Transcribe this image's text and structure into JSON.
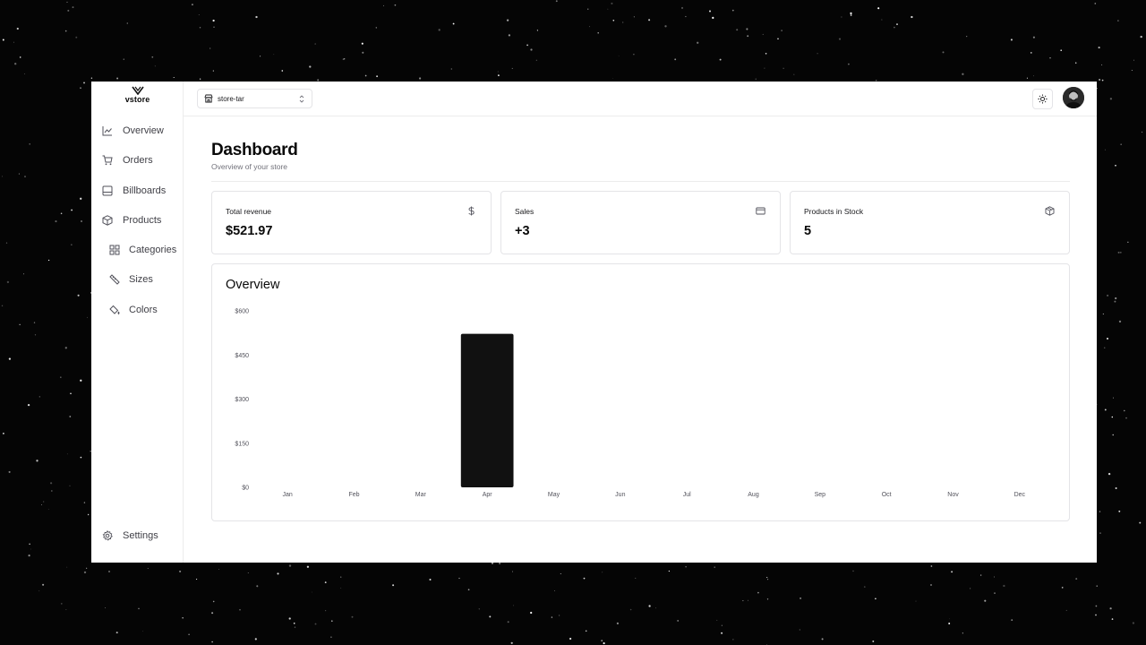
{
  "app": {
    "logo_text": "vstore"
  },
  "sidebar": {
    "items": [
      {
        "label": "Overview",
        "icon": "chart-line-icon"
      },
      {
        "label": "Orders",
        "icon": "cart-icon"
      },
      {
        "label": "Billboards",
        "icon": "billboard-icon"
      },
      {
        "label": "Products",
        "icon": "box-icon"
      },
      {
        "label": "Categories",
        "icon": "grid-icon"
      },
      {
        "label": "Sizes",
        "icon": "ruler-icon"
      },
      {
        "label": "Colors",
        "icon": "paint-bucket-icon"
      }
    ],
    "settings_label": "Settings"
  },
  "topbar": {
    "store_name": "store-tar",
    "store_icon": "store-icon",
    "theme_icon": "sun-icon"
  },
  "page": {
    "title": "Dashboard",
    "subtitle": "Overview of your store"
  },
  "stats": [
    {
      "label": "Total revenue",
      "value": "$521.97",
      "icon": "dollar-icon"
    },
    {
      "label": "Sales",
      "value": "+3",
      "icon": "credit-card-icon"
    },
    {
      "label": "Products in Stock",
      "value": "5",
      "icon": "package-icon"
    }
  ],
  "overview": {
    "title": "Overview"
  },
  "chart_data": {
    "type": "bar",
    "categories": [
      "Jan",
      "Feb",
      "Mar",
      "Apr",
      "May",
      "Jun",
      "Jul",
      "Aug",
      "Sep",
      "Oct",
      "Nov",
      "Dec"
    ],
    "values": [
      0,
      0,
      0,
      521.97,
      0,
      0,
      0,
      0,
      0,
      0,
      0,
      0
    ],
    "ytick_labels": [
      "$0",
      "$150",
      "$300",
      "$450",
      "$600"
    ],
    "yticks": [
      0,
      150,
      300,
      450,
      600
    ],
    "ylim": [
      0,
      600
    ],
    "bar_color": "#111111",
    "grid": false,
    "title": "Overview"
  }
}
